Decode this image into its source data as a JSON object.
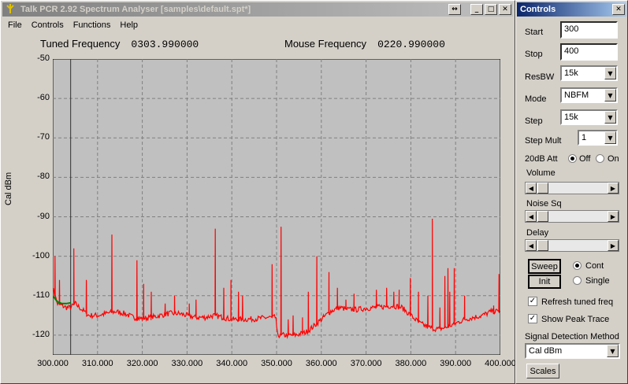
{
  "main_window": {
    "title": "Talk PCR 2.92 Spectrum Analyser [samples\\default.spt*]",
    "menu": [
      "File",
      "Controls",
      "Functions",
      "Help"
    ],
    "tuned_label": "Tuned Frequency",
    "tuned_value": "0303.990000",
    "mouse_label": "Mouse Frequency",
    "mouse_value": "0220.990000"
  },
  "controls_window": {
    "title": "Controls",
    "start_label": "Start",
    "start_value": "300",
    "stop_label": "Stop",
    "stop_value": "400",
    "resbw_label": "ResBW",
    "resbw_value": "15k",
    "mode_label": "Mode",
    "mode_value": "NBFM",
    "step_label": "Step",
    "step_value": "15k",
    "stepmult_label": "Step Mult",
    "stepmult_value": "1",
    "att_label": "20dB Att",
    "att_off": "Off",
    "att_on": "On",
    "volume_label": "Volume",
    "noise_label": "Noise Sq",
    "delay_label": "Delay",
    "sweep_button": "Sweep",
    "init_button": "Init",
    "cont_label": "Cont",
    "single_label": "Single",
    "refresh_label": "Refresh tuned freq",
    "peak_label": "Show Peak Trace",
    "sdm_label": "Signal Detection Method",
    "sdm_value": "Cal dBm",
    "scales_button": "Scales"
  },
  "chart_data": {
    "type": "line",
    "ylabel": "Cal dBm",
    "xlim": [
      300,
      400
    ],
    "ylim": [
      -125,
      -50
    ],
    "grid": true,
    "x_ticks": [
      "300.000",
      "310.000",
      "320.000",
      "330.000",
      "340.000",
      "350.000",
      "360.000",
      "370.000",
      "380.000",
      "390.000",
      "400.000"
    ],
    "y_ticks": [
      "-50",
      "-60",
      "-70",
      "-80",
      "-90",
      "-100",
      "-110",
      "-120"
    ],
    "tuned_marker": 303.99,
    "colors": {
      "trace": "#ff0000",
      "peak": "#008000",
      "grid": "#808080",
      "background": "#c0c0c0"
    },
    "baseline": [
      [
        300,
        -108
      ],
      [
        301,
        -112
      ],
      [
        302,
        -112.5
      ],
      [
        303,
        -113
      ],
      [
        304,
        -113
      ],
      [
        305,
        -112
      ],
      [
        306,
        -113
      ],
      [
        307,
        -114
      ],
      [
        308,
        -115
      ],
      [
        310,
        -115
      ],
      [
        312,
        -114.5
      ],
      [
        314,
        -114
      ],
      [
        316,
        -114.5
      ],
      [
        318,
        -115.5
      ],
      [
        320,
        -115.8
      ],
      [
        322,
        -115.5
      ],
      [
        324,
        -115
      ],
      [
        326,
        -114.5
      ],
      [
        328,
        -114.5
      ],
      [
        330,
        -115
      ],
      [
        332,
        -115.5
      ],
      [
        334,
        -115.5
      ],
      [
        336,
        -115
      ],
      [
        338,
        -115.5
      ],
      [
        340,
        -116
      ],
      [
        343,
        -116
      ],
      [
        346,
        -115.8
      ],
      [
        348,
        -115.5
      ],
      [
        349.9,
        -115.5
      ],
      [
        350.1,
        -120
      ],
      [
        352,
        -120
      ],
      [
        354,
        -120
      ],
      [
        356,
        -119.5
      ],
      [
        357,
        -119
      ],
      [
        358,
        -118
      ],
      [
        360,
        -116
      ],
      [
        362,
        -114
      ],
      [
        364,
        -113
      ],
      [
        366,
        -113.5
      ],
      [
        368,
        -113.5
      ],
      [
        370,
        -113.2
      ],
      [
        372,
        -113
      ],
      [
        374,
        -112.8
      ],
      [
        376,
        -112.5
      ],
      [
        378,
        -113
      ],
      [
        380,
        -115
      ],
      [
        382,
        -117
      ],
      [
        384,
        -118
      ],
      [
        386,
        -118.5
      ],
      [
        388,
        -118
      ],
      [
        390,
        -117
      ],
      [
        392,
        -116
      ],
      [
        394,
        -115.5
      ],
      [
        396,
        -115
      ],
      [
        398,
        -114
      ],
      [
        400,
        -114
      ]
    ],
    "peaks": [
      [
        300.5,
        -100
      ],
      [
        301.5,
        -106
      ],
      [
        304.7,
        -98
      ],
      [
        307.5,
        -106
      ],
      [
        313.2,
        -94.5
      ],
      [
        318.8,
        -101
      ],
      [
        320.3,
        -107
      ],
      [
        322.0,
        -109
      ],
      [
        325.1,
        -112
      ],
      [
        327.2,
        -110
      ],
      [
        330.5,
        -112
      ],
      [
        332.0,
        -111
      ],
      [
        336.3,
        -93
      ],
      [
        338.2,
        -108
      ],
      [
        339.8,
        -106
      ],
      [
        341.5,
        -109
      ],
      [
        342.4,
        -110
      ],
      [
        349.0,
        -102
      ],
      [
        351.0,
        -92.5
      ],
      [
        352.6,
        -116
      ],
      [
        353.7,
        -115
      ],
      [
        355.8,
        -115.5
      ],
      [
        357.1,
        -109
      ],
      [
        359.0,
        -100
      ],
      [
        360.6,
        -115
      ],
      [
        361.7,
        -104
      ],
      [
        363.6,
        -108
      ],
      [
        365.5,
        -111
      ],
      [
        367.3,
        -109.5
      ],
      [
        372.3,
        -108.5
      ],
      [
        374.6,
        -108
      ],
      [
        376.2,
        -109
      ],
      [
        377.4,
        -108.5
      ],
      [
        379.9,
        -105.5
      ],
      [
        381.7,
        -109
      ],
      [
        383.8,
        -110
      ],
      [
        384.8,
        -90.5
      ],
      [
        386.5,
        -113
      ],
      [
        387.6,
        -105
      ],
      [
        388.3,
        -103
      ],
      [
        388.7,
        -109
      ],
      [
        389.7,
        -103
      ],
      [
        392.0,
        -110
      ],
      [
        398.5,
        -112.5
      ],
      [
        399.7,
        -104.5
      ]
    ],
    "peak_trace": [
      [
        300,
        -110
      ],
      [
        301,
        -111.5
      ],
      [
        302,
        -112
      ],
      [
        303,
        -112
      ],
      [
        304,
        -111.8
      ]
    ]
  }
}
